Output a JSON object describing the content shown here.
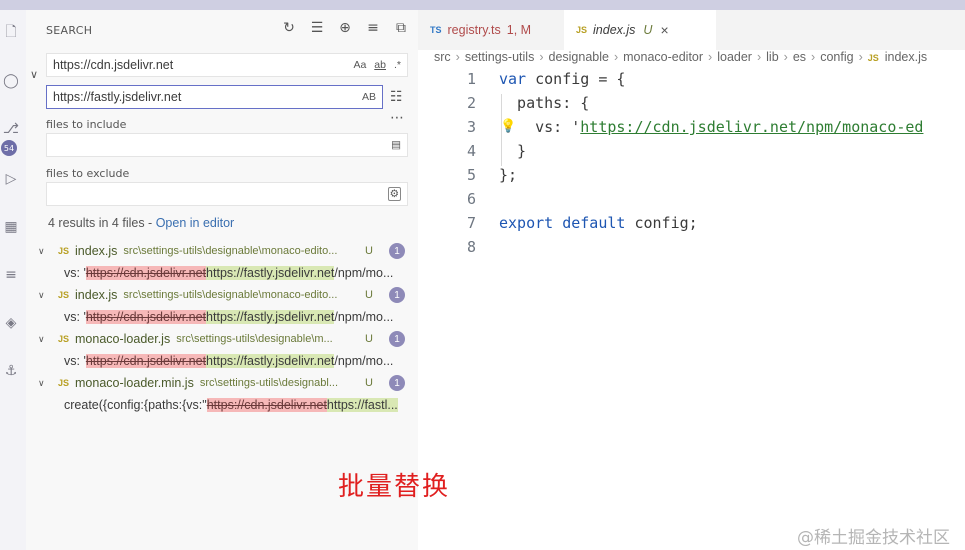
{
  "search": {
    "title": "SEARCH",
    "find_value": "https://cdn.jsdelivr.net",
    "find_opts": [
      "Aa",
      "ab",
      ".*"
    ],
    "replace_value": "https://fastly.jsdelivr.net",
    "replace_opt": "AB",
    "include_label": "files to include",
    "include_value": "",
    "exclude_label": "files to exclude",
    "exclude_value": "",
    "summary": "4 results in 4 files - ",
    "open_in_editor": "Open in editor"
  },
  "results": [
    {
      "name": "index.js",
      "path": "src\\settings-utils\\designable\\monaco-edito...",
      "status": "U",
      "count": "1",
      "prefix": "vs: '",
      "del": "https://cdn.jsdelivr.net",
      "ins": "https://fastly.jsdelivr.net",
      "suffix": "/npm/mo..."
    },
    {
      "name": "index.js",
      "path": "src\\settings-utils\\designable\\monaco-edito...",
      "status": "U",
      "count": "1",
      "prefix": "vs: '",
      "del": "https://cdn.jsdelivr.net",
      "ins": "https://fastly.jsdelivr.net",
      "suffix": "/npm/mo..."
    },
    {
      "name": "monaco-loader.js",
      "path": "src\\settings-utils\\designable\\m...",
      "status": "U",
      "count": "1",
      "prefix": "vs: '",
      "del": "https://cdn.jsdelivr.net",
      "ins": "https://fastly.jsdelivr.net",
      "suffix": "/npm/mo..."
    },
    {
      "name": "monaco-loader.min.js",
      "path": "src\\settings-utils\\designabl...",
      "status": "U",
      "count": "1",
      "prefix": "create({config:{paths:{vs:\"",
      "del": "https://cdn.jsdelivr.net",
      "ins": "https://fastl...",
      "suffix": ""
    }
  ],
  "tabs": [
    {
      "type": "TS",
      "name": "registry.ts",
      "status": "1, M"
    },
    {
      "type": "JS",
      "name": "index.js",
      "status": "U",
      "close": "×"
    }
  ],
  "breadcrumb": [
    "src",
    "settings-utils",
    "designable",
    "monaco-editor",
    "loader",
    "lib",
    "es",
    "config",
    "index.js"
  ],
  "code": {
    "line_numbers": [
      "1",
      "2",
      "3",
      "4",
      "5",
      "6",
      "7",
      "8"
    ],
    "l1_kw": "var",
    "l1_rest": " config = {",
    "l2": "  paths: {",
    "l3_pre": "    vs: '",
    "l3_url": "https://cdn.jsdelivr.net/npm/monaco-ed",
    "l4": "  }",
    "l5": "};",
    "l7_kw": "export default",
    "l7_rest": " config;"
  },
  "activity_badge": "54",
  "annotation": "批量替换",
  "watermark": "@稀土掘金技术社区"
}
